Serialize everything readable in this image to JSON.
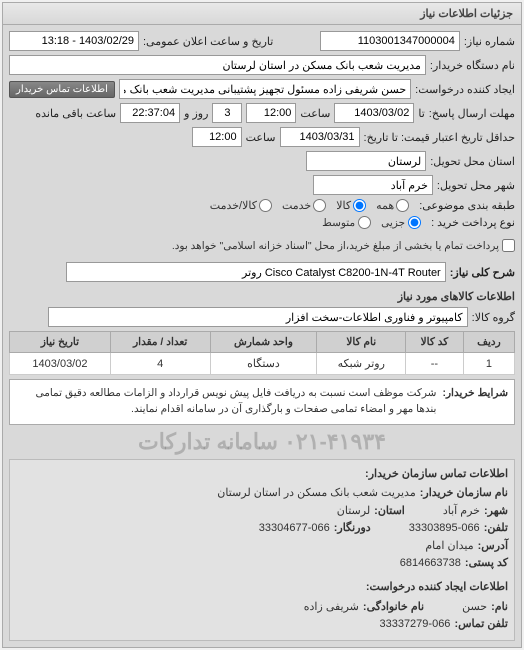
{
  "panel_title": "جزئیات اطلاعات نیاز",
  "labels": {
    "req_number": "شماره نیاز:",
    "pub_datetime": "تاریخ و ساعت اعلان عمومی:",
    "buyer_device": "نام دستگاه خریدار:",
    "creator": "ایجاد کننده درخواست:",
    "creator_contact_btn": "اطلاعات تماس خریدار",
    "deadline": "مهلت ارسال پاسخ:",
    "deadline_to": "تا",
    "remaining": "ساعت باقی مانده",
    "days_and": "روز و",
    "validity": "حداقل تاریخ اعتبار قیمت: تا تاریخ:",
    "province": "استان محل تحویل:",
    "city": "شهر محل تحویل:",
    "priority": "طبقه بندی موضوعی:",
    "purchase_type": "نوع پرداخت خرید :",
    "need_title": "شرح کلی نیاز:",
    "items_title": "اطلاعات کالاهای مورد نیاز",
    "goods_group": "گروه کالا:",
    "buyer_desc": "شرایط خریدار:",
    "contact_title1": "اطلاعات تماس سازمان خریدار:",
    "org_name": "نام سازمان خریدار:",
    "city2": "شهر:",
    "province2": "استان:",
    "phone": "تلفن:",
    "fax": "دورنگار:",
    "address": "آدرس:",
    "postal": "کد پستی:",
    "contact_title2": "اطلاعات ایجاد کننده درخواست:",
    "name": "نام:",
    "family": "نام خانوادگی:",
    "contact_phone": "تلفن تماس:"
  },
  "values": {
    "req_number": "1103001347000004",
    "pub_datetime": "1403/02/29 - 13:18",
    "buyer_device": "مدیریت شعب بانک مسکن در استان لرستان",
    "creator": "حسن شریفی زاده مسئول تجهیز پشتیبانی مدیریت شعب بانک مسکن در استا",
    "deadline_date": "1403/03/02",
    "deadline_time": "12:00",
    "days": "3",
    "remaining_time": "22:37:04",
    "validity_date": "1403/03/31",
    "validity_time": "12:00",
    "province": "لرستان",
    "city": "خرم آباد",
    "need_title": "Cisco Catalyst C8200-1N-4T Router روتر",
    "goods_group": "کامپیوتر و فناوری اطلاعات-سخت افزار",
    "buyer_desc": "شرکت موظف است نسبت به دریافت فایل پیش نویس قرارداد و الزامات مطالعه دقیق تمامی بندها مهر و امضاء تمامی صفحات و بارگذاری آن در سامانه اقدام نمایند.",
    "watermark": "۰۲۱-۴۱۹۳۴ سامانه تدارکات",
    "org_name": "مدیریت شعب بانک مسکن در استان لرستان",
    "city2": "خرم آباد",
    "province2": "لرستان",
    "phone": "33303895-066",
    "fax": "33304677-066",
    "address": "میدان امام",
    "postal": "6814663738",
    "name": "حسن",
    "family": "شریفی زاده",
    "contact_phone": "33337279-066"
  },
  "priority_options": {
    "all": "همه",
    "goods": "کالا",
    "service": "خدمت",
    "both": "کالا/خدمت"
  },
  "purchase_options": {
    "low": "جزیی",
    "mid": "متوسط",
    "note": "پرداخت تمام یا بخشی از مبلغ خرید،از محل \"اسناد خزانه اسلامی\" خواهد بود."
  },
  "table": {
    "headers": {
      "row": "ردیف",
      "code": "کد کالا",
      "name": "نام کالا",
      "unit": "واحد شمارش",
      "qty": "تعداد / مقدار",
      "date": "تاریخ نیاز"
    },
    "rows": [
      {
        "row": "1",
        "code": "--",
        "name": "روتر شبکه",
        "unit": "دستگاه",
        "qty": "4",
        "date": "1403/03/02"
      }
    ]
  }
}
